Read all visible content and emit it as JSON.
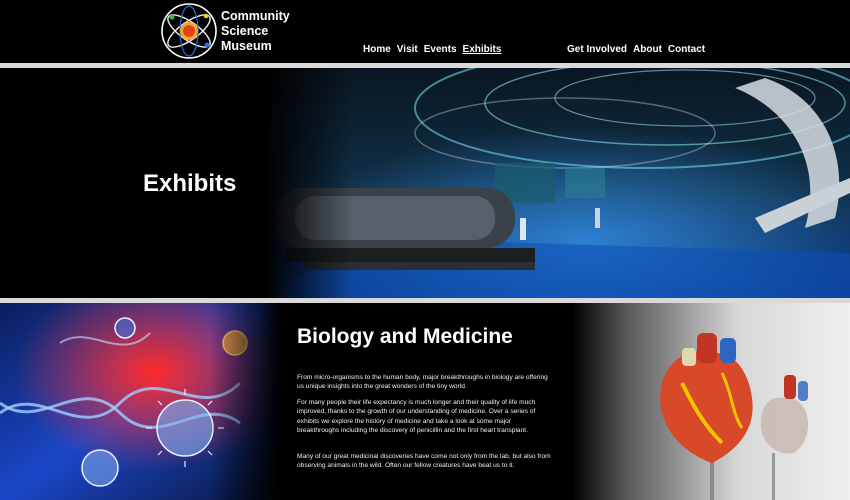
{
  "header": {
    "logo_lines": [
      "Community",
      "Science",
      "Museum"
    ],
    "nav_left": [
      "Home",
      "Visit",
      "Events",
      "Exhibits"
    ],
    "nav_right": [
      "Get Involved",
      "About",
      "Contact"
    ],
    "active": "Exhibits"
  },
  "hero": {
    "title": "Exhibits"
  },
  "section": {
    "title": "Biology and Medicine",
    "paragraphs": [
      "From micro-organisms to the human body, major breakthroughs in biology are offering us unique insights into the great wonders of the tiny world.",
      "For many people their life expectancy is much longer and their quality of life much improved, thanks to the growth of our understanding of medicine. Over a series of exhibits we explore the history of medicine and take a look at some major breakthroughs including the discovery of penicillin and the first heart transplant.",
      "Many of our great medicinal discoveries have come not only from the lab, but also from observing animals in the wild. Often our fellow creatures have beat us to it."
    ]
  },
  "colors": {
    "background": "#000000",
    "divider": "#d9d9d9",
    "logo_sun": "#f5a623"
  },
  "icons": [
    "atom-logo-icon"
  ]
}
